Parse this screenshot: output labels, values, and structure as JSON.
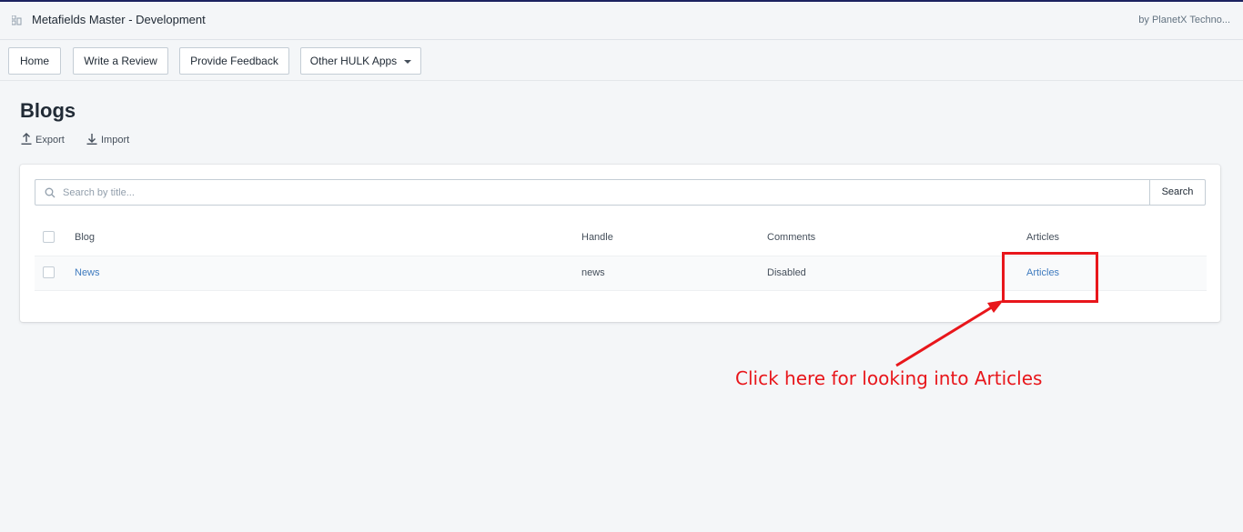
{
  "app": {
    "title": "Metafields Master - Development",
    "vendor": "by PlanetX Techno..."
  },
  "nav": {
    "home": "Home",
    "write_review": "Write a Review",
    "feedback": "Provide Feedback",
    "other_apps": "Other HULK Apps"
  },
  "page": {
    "title": "Blogs",
    "export": "Export",
    "import": "Import"
  },
  "search": {
    "placeholder": "Search by title...",
    "button": "Search"
  },
  "table": {
    "headers": {
      "blog": "Blog",
      "handle": "Handle",
      "comments": "Comments",
      "articles": "Articles"
    },
    "rows": [
      {
        "blog": "News",
        "handle": "news",
        "comments": "Disabled",
        "articles": "Articles"
      }
    ]
  },
  "annotation": {
    "text": "Click here for looking into Articles",
    "color": "#e8161b"
  },
  "colors": {
    "link": "#3f7bbf",
    "accent_border": "#1c2260"
  }
}
